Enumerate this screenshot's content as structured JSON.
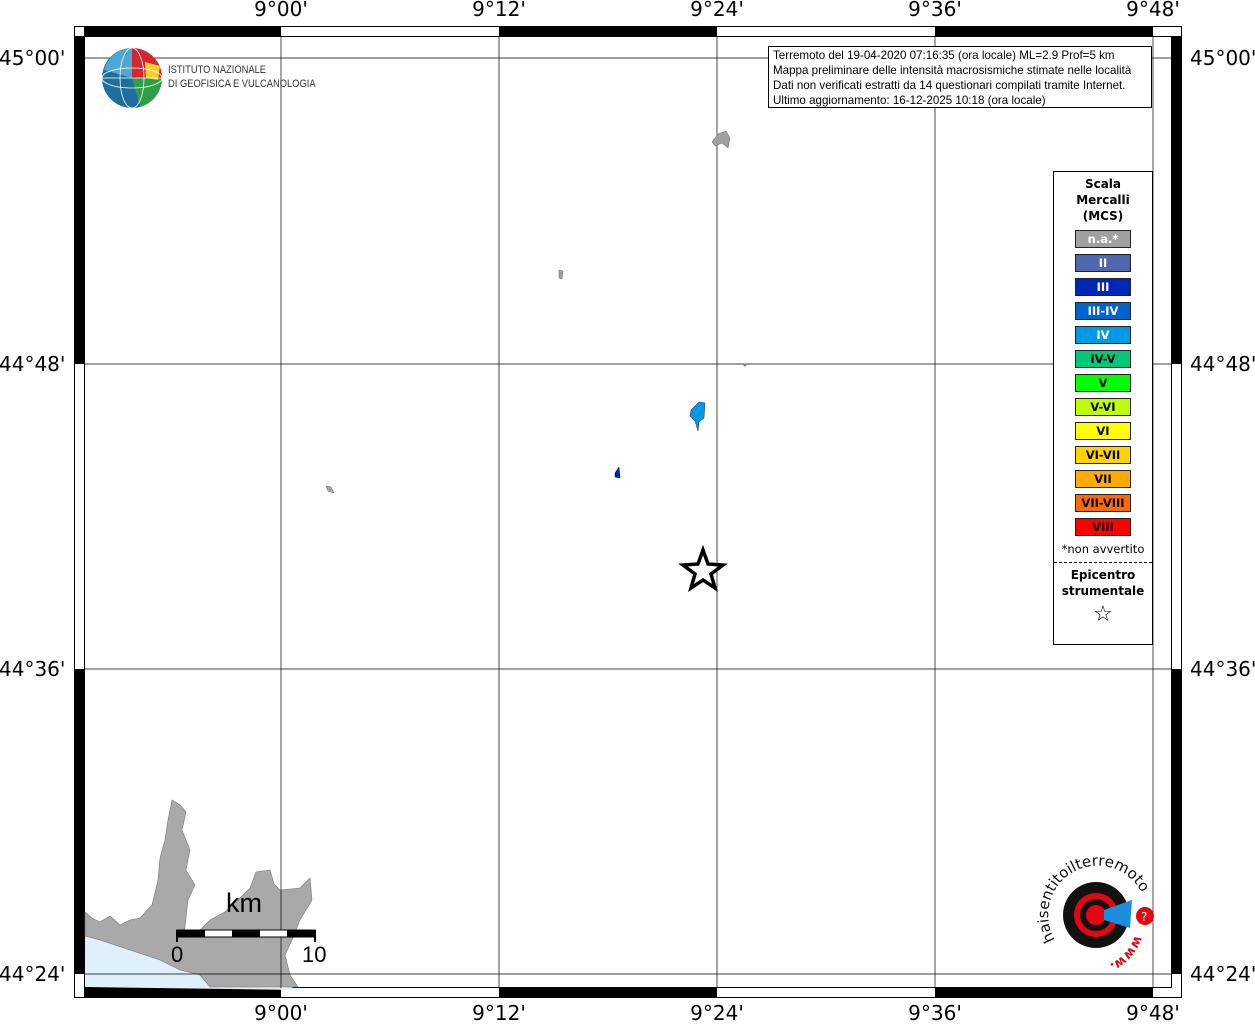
{
  "info": {
    "lines": [
      "Terremoto del 19-04-2020 07:16:35 (ora locale) ML=2.9 Prof=5 km",
      "Mappa preliminare delle intensità macrosismiche stimate nelle località",
      "Dati non verificati estratti da 14 questionari compilati tramite Internet.",
      "Ultimo aggiornamento: 16-12-2025 10:18 (ora locale)"
    ]
  },
  "axes": {
    "x_labels": [
      "9°00'",
      "9°12'",
      "9°24'",
      "9°36'",
      "9°48'"
    ],
    "y_labels": [
      "45°00'",
      "44°48'",
      "44°36'",
      "44°24'"
    ]
  },
  "logo_ingv": {
    "line1": "ISTITUTO NAZIONALE",
    "line2": "DI GEOFISICA E VULCANOLOGIA"
  },
  "logo_hsit": {
    "text": "haisentitoilterremoto.it",
    "www": "www."
  },
  "legend": {
    "title": [
      "Scala",
      "Mercalli",
      "(MCS)"
    ],
    "items": [
      {
        "label": "n.a.*",
        "color": "#a0a0a0",
        "text": "#ffffff"
      },
      {
        "label": "II",
        "color": "#4e67ae",
        "text": "#ffffff"
      },
      {
        "label": "III",
        "color": "#0027b8",
        "text": "#ffffff"
      },
      {
        "label": "III-IV",
        "color": "#0063cc",
        "text": "#ffffff"
      },
      {
        "label": "IV",
        "color": "#0099e6",
        "text": "#ffffff"
      },
      {
        "label": "IV-V",
        "color": "#00c878",
        "text": "#000000"
      },
      {
        "label": "V",
        "color": "#00ff00",
        "text": "#000000"
      },
      {
        "label": "V-VI",
        "color": "#c0ff00",
        "text": "#000000"
      },
      {
        "label": "VI",
        "color": "#ffff00",
        "text": "#000000"
      },
      {
        "label": "VI-VII",
        "color": "#ffd200",
        "text": "#000000"
      },
      {
        "label": "VII",
        "color": "#ffaa00",
        "text": "#000000"
      },
      {
        "label": "VII-VIII",
        "color": "#ff6a00",
        "text": "#000000"
      },
      {
        "label": "VIII",
        "color": "#ff0000",
        "text": "#000000"
      }
    ],
    "note": "*non avvertito",
    "epicenter": [
      "Epicentro",
      "strumentale"
    ],
    "star": "☆"
  },
  "scale_bar": {
    "unit": "km",
    "min": "0",
    "max": "10"
  }
}
